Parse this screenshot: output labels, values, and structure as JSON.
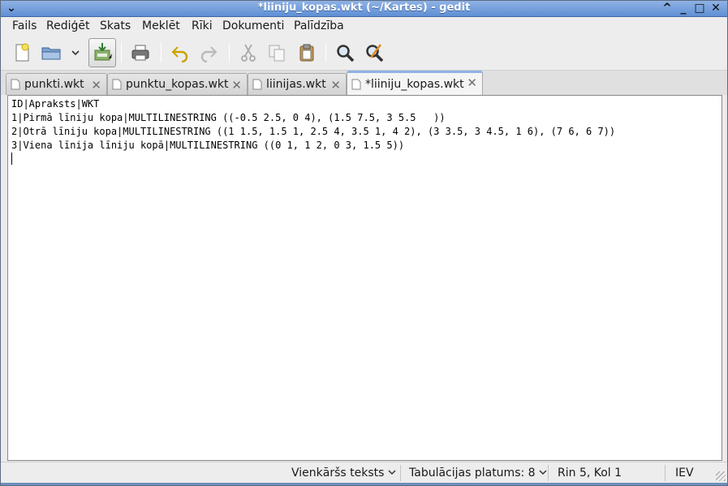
{
  "window": {
    "title": "*liiniju_kopas.wkt (~/Kartes) - gedit"
  },
  "menu": [
    "Fails",
    "Rediģēt",
    "Skats",
    "Meklēt",
    "Rīki",
    "Dokumenti",
    "Palīdzība"
  ],
  "toolbar": {
    "icons": [
      "new-document-icon",
      "open-folder-icon",
      "chevron-down-icon",
      "save-icon",
      "print-icon",
      "undo-icon",
      "redo-icon",
      "cut-icon",
      "copy-icon",
      "paste-icon",
      "search-icon",
      "search-replace-icon"
    ]
  },
  "tabs": [
    {
      "label": "punkti.wkt",
      "active": false
    },
    {
      "label": "punktu_kopas.wkt",
      "active": false
    },
    {
      "label": "liinijas.wkt",
      "active": false
    },
    {
      "label": "*liiniju_kopas.wkt",
      "active": true
    }
  ],
  "editor": {
    "lines": [
      "ID|Apraksts|WKT",
      "1|Pirmā līniju kopa|MULTILINESTRING ((-0.5 2.5, 0 4), (1.5 7.5, 3 5.5   ))",
      "2|Otrā līniju kopa|MULTILINESTRING ((1 1.5, 1.5 1, 2.5 4, 3.5 1, 4 2), (3 3.5, 3 4.5, 1 6), (7 6, 6 7))",
      "3|Viena līnija līniju kopā|MULTILINESTRING ((0 1, 1 2, 0 3, 1.5 5))",
      ""
    ]
  },
  "status": {
    "language": "Vienkāršs teksts",
    "tab_width_label": "Tabulācijas platums:",
    "tab_width_value": "8",
    "position": "Rin 5, Kol 1",
    "mode": "IEV"
  },
  "colors": {
    "titlebar": "#6f9bdc",
    "tab_active_accent": "#8fb2e4"
  }
}
